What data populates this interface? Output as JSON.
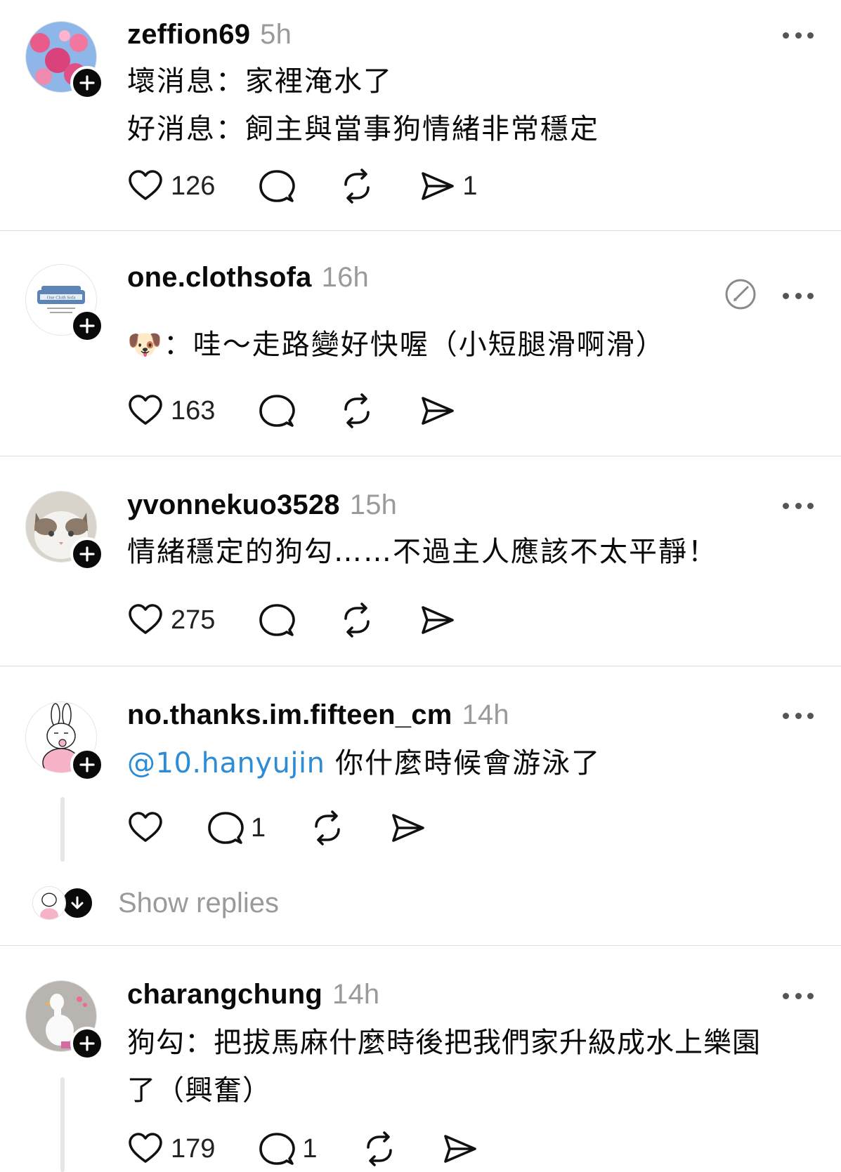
{
  "posts": [
    {
      "username": "zeffion69",
      "time": "5h",
      "lines": [
        "壞消息：家裡淹水了",
        "好消息：飼主與當事狗情緒非常穩定"
      ],
      "likes": "126",
      "replies": "",
      "shares": "1",
      "avatar": "pink-blossom-avatar"
    },
    {
      "username": "one.clothsofa",
      "time": "16h",
      "emoji": "🐶",
      "lines": [
        "：哇～走路變好快喔（小短腿滑啊滑）"
      ],
      "likes": "163",
      "replies": "",
      "shares": "",
      "avatar": "sofa-logo-avatar",
      "avatar_text": "One Cloth Sofa"
    },
    {
      "username": "yvonnekuo3528",
      "time": "15h",
      "lines": [
        "情緒穩定的狗勾……不過主人應該不太平靜！"
      ],
      "likes": "275",
      "replies": "",
      "shares": "",
      "avatar": "cat-avatar"
    },
    {
      "username": "no.thanks.im.fifteen_cm",
      "time": "14h",
      "mention": "@10.hanyujin",
      "lines": [
        "你什麼時候會游泳了"
      ],
      "likes": "",
      "replies": "1",
      "shares": "",
      "avatar": "pink-bunny-avatar"
    },
    {
      "username": "charangchung",
      "time": "14h",
      "lines": [
        "狗勾：把拔馬麻什麼時後把我們家升級成水上樂園",
        "了（興奮）"
      ],
      "likes": "179",
      "replies": "1",
      "shares": "",
      "avatar": "white-duck-avatar"
    }
  ],
  "show_replies_label": "Show replies",
  "colors": {
    "mention": "#2d8cd6",
    "muted": "#9a9a9a",
    "divider": "#dcdcdc"
  }
}
